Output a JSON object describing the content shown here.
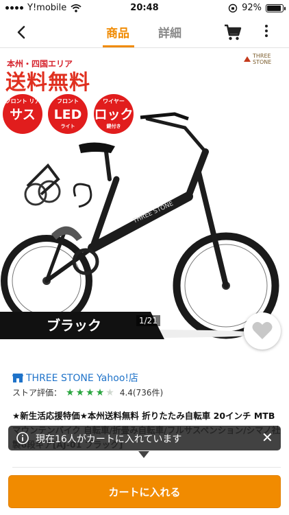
{
  "status_bar": {
    "carrier": "Y!mobile",
    "time": "20:48",
    "battery": "92%",
    "battery_level": 0.92
  },
  "nav": {
    "back_icon": "chevron-left-icon",
    "tabs": [
      {
        "label": "商品",
        "active": true
      },
      {
        "label": "詳細",
        "active": false
      }
    ],
    "cart_icon": "cart-icon",
    "more_icon": "more-vertical-icon"
  },
  "product_image": {
    "promo_region": "本州・四国エリア",
    "promo_main": "送料無料",
    "brand_logo": "THREE STONE",
    "badges": [
      {
        "top": "フロント リア",
        "big": "サス",
        "bottom": ""
      },
      {
        "top": "フロント",
        "big": "LED",
        "bottom": "ライト"
      },
      {
        "top": "ワイヤー",
        "big": "ロック",
        "bottom": "鍵付き"
      }
    ],
    "frame_text": "THREE STONE",
    "color_label": "ブラック",
    "counter": "1/21",
    "favorite_icon": "heart-icon"
  },
  "store": {
    "name": "THREE STONE Yahoo!店",
    "rating_label": "ストア評価：",
    "rating_value": 4.4,
    "rating_text": "4.4(736件)"
  },
  "product": {
    "title": "★新生活応援特価★本州送料無料 折りたたみ自転車 20インチ MTB マウンテンバイク 自転車/折畳み自転車/フルサスペンション/シマノ社製6段ギア[AJ-01 ブラック]"
  },
  "toast": {
    "text": "現在16人がカートに入れています",
    "close_label": "✕"
  },
  "colors": {
    "accent": "#f18b00",
    "promo_red": "#e03020",
    "link_blue": "#1f73c9",
    "star_green": "#2aa53f"
  },
  "add_to_cart": {
    "label": "カートに入れる"
  }
}
